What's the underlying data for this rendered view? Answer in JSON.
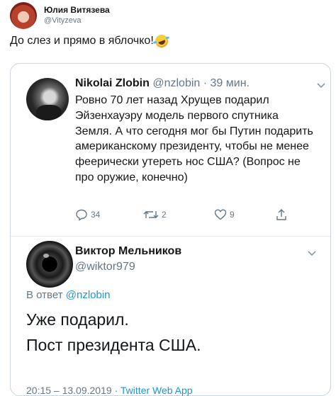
{
  "outer": {
    "author_name": "Юлия Витязева",
    "author_handle": "@Vityzeva",
    "text": "До слез и прямо в яблочко!",
    "emoji_icon": "rolling-on-floor-laughing-emoji"
  },
  "quoted": {
    "author_name": "Nikolai Zlobin",
    "author_handle": "@nzlobin",
    "time": "· 39 мин.",
    "text": "Ровно 70 лет назад Хрущев подарил Эйзенхауэру модель первого спутника Земля. А что сегодня мог бы Путин подарить американскому президенту, чтобы не менее феерически утереть нос США? (Вопрос не про оружие, конечно)",
    "replies": "34",
    "retweets": "2",
    "likes": "9"
  },
  "reply": {
    "author_name": "Виктор Мельников",
    "author_handle": "@wiktor979",
    "reply_prefix": "В ответ",
    "reply_to": "@nzlobin",
    "lines": [
      "Уже подарил.",
      "Пост президента США."
    ],
    "footer_time": "20:15 – 13.09.2019",
    "footer_source": "Twitter Web App"
  },
  "colors": {
    "text": "#14171a",
    "muted": "#657786",
    "link": "#1b95e0",
    "border": "#ccd6dd"
  }
}
